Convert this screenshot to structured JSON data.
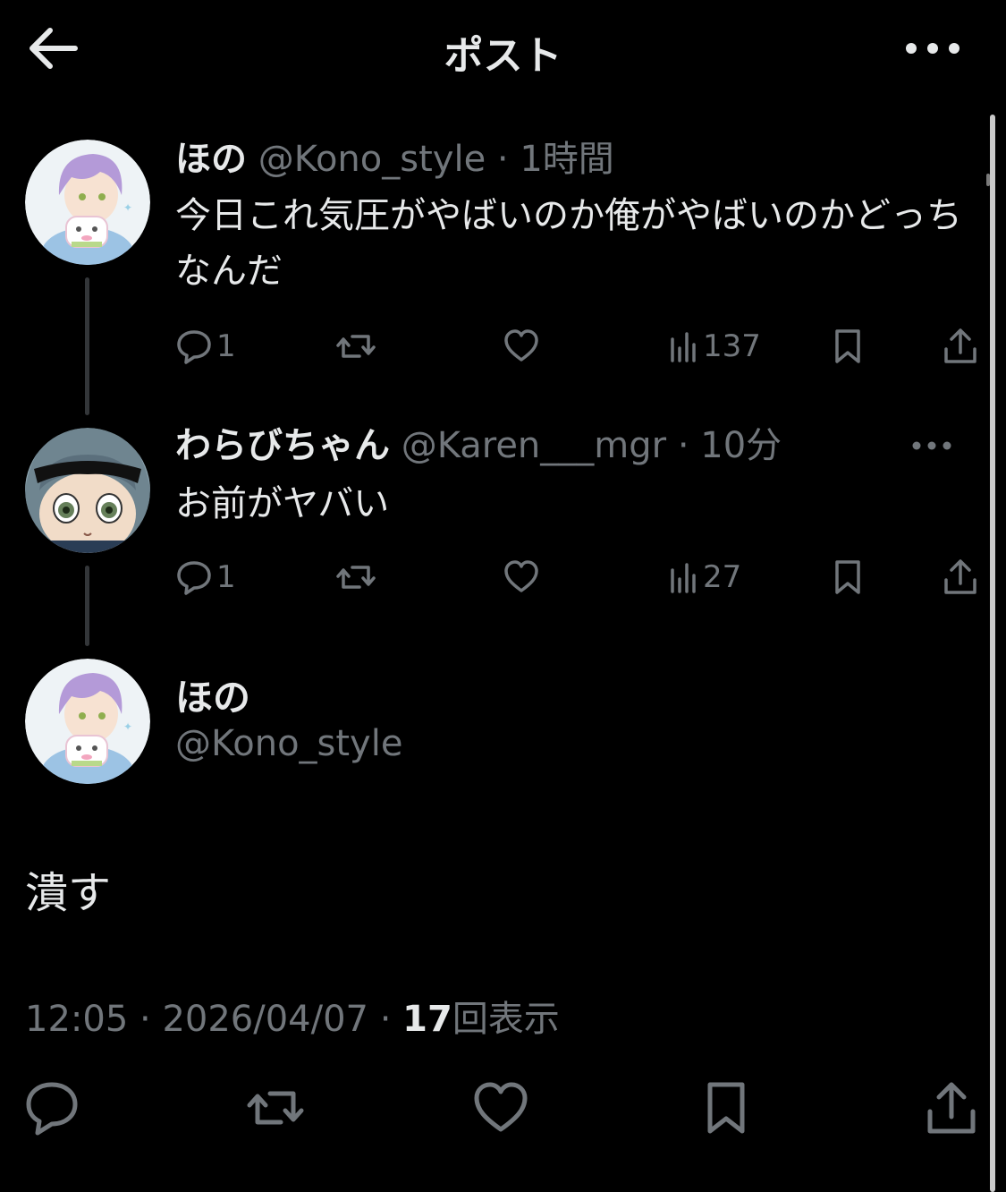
{
  "header": {
    "title": "ポスト"
  },
  "thread": [
    {
      "name": "ほの",
      "handle": "@Kono_style",
      "separator": "·",
      "time": "1時間",
      "text": "今日これ気圧がやばいのか俺がやばいのかどっちなんだ",
      "replies": "1",
      "views": "137",
      "avatar": "purple-hair-character-avatar"
    },
    {
      "name": "わらびちゃん",
      "handle": "@Karen___mgr",
      "separator": "·",
      "time": "10分",
      "text": "お前がヤバい",
      "replies": "1",
      "views": "27",
      "avatar": "sunglasses-plush-avatar"
    }
  ],
  "main": {
    "name": "ほの",
    "handle": "@Kono_style",
    "text": "潰す",
    "time": "12:05",
    "date": "2026/04/07",
    "views_count": "17",
    "views_label": "回表示",
    "separator": "·"
  },
  "colors": {
    "background": "#000000",
    "text": "#e7e9ea",
    "muted": "#71767b",
    "thread_line": "#333639"
  },
  "icons": [
    "back-arrow-icon",
    "more-icon",
    "reply-icon",
    "retweet-icon",
    "like-icon",
    "views-icon",
    "bookmark-icon",
    "share-icon"
  ]
}
